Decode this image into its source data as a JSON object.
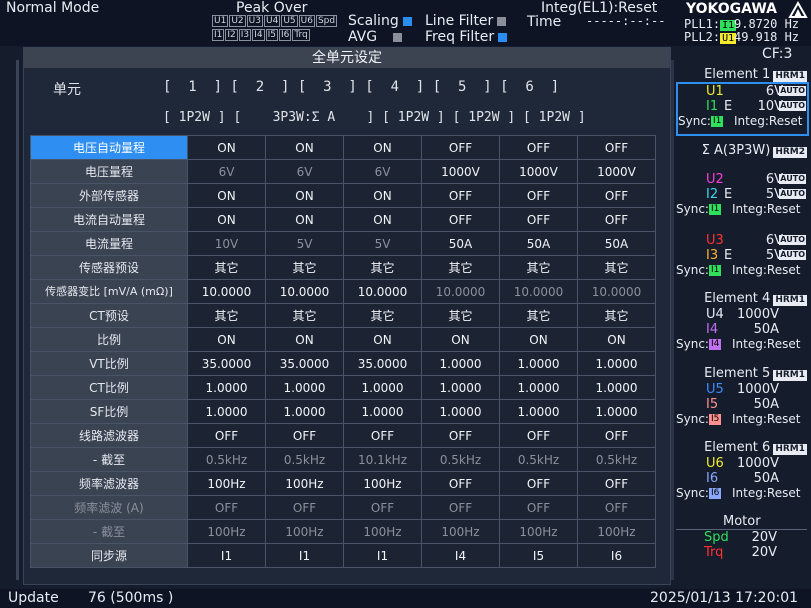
{
  "topbar": {
    "mode": "Normal Mode",
    "peak_over": "Peak Over",
    "indicators_row1": [
      "U1",
      "U2",
      "U3",
      "U4",
      "U5",
      "U6",
      "Spd"
    ],
    "indicators_row2": [
      "I1",
      "I2",
      "I3",
      "I4",
      "I5",
      "I6",
      "Trq"
    ],
    "scaling": "Scaling",
    "avg": "AVG",
    "line_filter": "Line Filter",
    "freq_filter": "Freq Filter",
    "integ": "Integ(EL1):Reset",
    "time_label": "Time",
    "time_value": "-----:--:--",
    "brand": "YOKOGAWA",
    "pll1_label": "PLL1:",
    "pll1_badge": "I1",
    "pll1_value": "9.8720 Hz",
    "pll2_label": "PLL2:",
    "pll2_badge": "U1",
    "pll2_value": "49.918 Hz",
    "cf": "CF:3"
  },
  "panel": {
    "title": "全单元设定",
    "unit_label": "单元",
    "units_line": "[  1  ] [  2  ] [  3  ] [  4  ] [  5  ] [  6  ]",
    "wiring_line": "[ 1P2W ] [    3P3W:Σ A    ] [ 1P2W ] [ 1P2W ] [ 1P2W ]"
  },
  "rows": [
    {
      "label": "电压自动量程",
      "values": [
        "ON",
        "ON",
        "ON",
        "OFF",
        "OFF",
        "OFF"
      ],
      "selected": true
    },
    {
      "label": "电压量程",
      "values": [
        "6V",
        "6V",
        "6V",
        "1000V",
        "1000V",
        "1000V"
      ],
      "dim": [
        true,
        true,
        true,
        false,
        false,
        false
      ]
    },
    {
      "label": "外部传感器",
      "values": [
        "ON",
        "ON",
        "ON",
        "OFF",
        "OFF",
        "OFF"
      ]
    },
    {
      "label": "电流自动量程",
      "values": [
        "ON",
        "ON",
        "ON",
        "OFF",
        "OFF",
        "OFF"
      ]
    },
    {
      "label": "电流量程",
      "values": [
        "10V",
        "5V",
        "5V",
        "50A",
        "50A",
        "50A"
      ],
      "dim": [
        true,
        true,
        true,
        false,
        false,
        false
      ]
    },
    {
      "label": "传感器预设",
      "values": [
        "其它",
        "其它",
        "其它",
        "其它",
        "其它",
        "其它"
      ]
    },
    {
      "label": "传感器变比 [mV/A (mΩ)]",
      "values": [
        "10.0000",
        "10.0000",
        "10.0000",
        "10.0000",
        "10.0000",
        "10.0000"
      ],
      "dim": [
        false,
        false,
        false,
        true,
        true,
        true
      ],
      "small": true
    },
    {
      "label": "CT预设",
      "values": [
        "其它",
        "其它",
        "其它",
        "其它",
        "其它",
        "其它"
      ]
    },
    {
      "label": "比例",
      "values": [
        "ON",
        "ON",
        "ON",
        "ON",
        "ON",
        "ON"
      ]
    },
    {
      "label": "VT比例",
      "values": [
        "35.0000",
        "35.0000",
        "35.0000",
        "1.0000",
        "1.0000",
        "1.0000"
      ]
    },
    {
      "label": "CT比例",
      "values": [
        "1.0000",
        "1.0000",
        "1.0000",
        "1.0000",
        "1.0000",
        "1.0000"
      ]
    },
    {
      "label": "SF比例",
      "values": [
        "1.0000",
        "1.0000",
        "1.0000",
        "1.0000",
        "1.0000",
        "1.0000"
      ]
    },
    {
      "label": "线路滤波器",
      "values": [
        "OFF",
        "OFF",
        "OFF",
        "OFF",
        "OFF",
        "OFF"
      ]
    },
    {
      "label": "- 截至",
      "values": [
        "0.5kHz",
        "0.5kHz",
        "10.1kHz",
        "0.5kHz",
        "0.5kHz",
        "0.5kHz"
      ],
      "dim": [
        true,
        true,
        true,
        true,
        true,
        true
      ]
    },
    {
      "label": "频率滤波器",
      "values": [
        "100Hz",
        "100Hz",
        "100Hz",
        "OFF",
        "OFF",
        "OFF"
      ]
    },
    {
      "label": "频率滤波 (A)",
      "values": [
        "OFF",
        "OFF",
        "OFF",
        "OFF",
        "OFF",
        "OFF"
      ],
      "dim": [
        true,
        true,
        true,
        true,
        true,
        true
      ],
      "label_dim": true
    },
    {
      "label": "- 截至",
      "values": [
        "100Hz",
        "100Hz",
        "100Hz",
        "100Hz",
        "100Hz",
        "100Hz"
      ],
      "dim": [
        true,
        true,
        true,
        true,
        true,
        true
      ],
      "label_dim": true
    },
    {
      "label": "同步源",
      "values": [
        "I1",
        "I1",
        "I1",
        "I4",
        "I5",
        "I6"
      ]
    }
  ],
  "right": {
    "el1": {
      "title": "Element 1",
      "hrm": "HRM1",
      "u": "U1",
      "u_val": "6V",
      "i": "I1",
      "i_e": "E",
      "i_val": "10V",
      "auto": "AUTO",
      "sync": "Sync:",
      "sync_badge": "I1",
      "integ": "Integ:Reset"
    },
    "sigma": {
      "title": "Σ A(3P3W)",
      "hrm": "HRM2"
    },
    "el2": {
      "u": "U2",
      "u_val": "6V",
      "i": "I2",
      "i_e": "E",
      "i_val": "5V",
      "auto": "AUTO",
      "sync": "Sync:",
      "sync_badge": "I1",
      "integ": "Integ:Reset"
    },
    "el3": {
      "u": "U3",
      "u_val": "6V",
      "i": "I3",
      "i_e": "E",
      "i_val": "5V",
      "auto": "AUTO",
      "sync": "Sync:",
      "sync_badge": "I1",
      "integ": "Integ:Reset"
    },
    "el4": {
      "title": "Element 4",
      "hrm": "HRM1",
      "u": "U4",
      "u_val": "1000V",
      "i": "I4",
      "i_val": "50A",
      "sync": "Sync:",
      "sync_badge": "I4",
      "integ": "Integ:Reset"
    },
    "el5": {
      "title": "Element 5",
      "hrm": "HRM1",
      "u": "U5",
      "u_val": "1000V",
      "i": "I5",
      "i_val": "50A",
      "sync": "Sync:",
      "sync_badge": "I5",
      "integ": "Integ:Reset"
    },
    "el6": {
      "title": "Element 6",
      "hrm": "HRM1",
      "u": "U6",
      "u_val": "1000V",
      "i": "I6",
      "i_val": "50A",
      "sync": "Sync:",
      "sync_badge": "I6",
      "integ": "Integ:Reset"
    },
    "motor": {
      "title": "Motor",
      "spd": "Spd",
      "spd_val": "20V",
      "trq": "Trq",
      "trq_val": "20V"
    }
  },
  "bottombar": {
    "update": "Update",
    "update_value": "76 (500ms  )",
    "datetime": "2025/01/13 17:20:01"
  },
  "colors": {
    "u1": "#f2ea2a",
    "i1": "#2ee05a",
    "u2": "#ff3ad8",
    "i2": "#3ad8f0",
    "u3": "#ff3030",
    "i3": "#ffb030",
    "u4": "#e8ecf2",
    "i4": "#c070f0",
    "u5": "#3a8cff",
    "i5": "#ff9090",
    "u6": "#f2ea2a",
    "i6": "#8aa8ff",
    "spd": "#2ee05a",
    "trq": "#ff3030",
    "selected": "#2f8ef2"
  }
}
